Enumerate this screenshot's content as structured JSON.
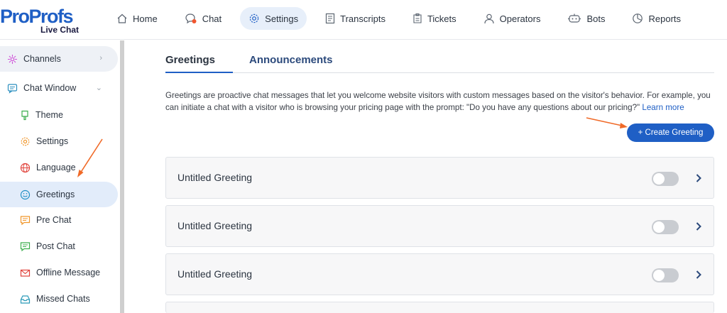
{
  "brand": {
    "logo_part1": "Pro",
    "logo_part2": "Profs",
    "product": "Live Chat"
  },
  "nav": [
    {
      "label": "Home",
      "icon": "home-icon"
    },
    {
      "label": "Chat",
      "icon": "chat-icon"
    },
    {
      "label": "Settings",
      "icon": "gear-icon",
      "active": true
    },
    {
      "label": "Transcripts",
      "icon": "transcripts-icon"
    },
    {
      "label": "Tickets",
      "icon": "tickets-icon"
    },
    {
      "label": "Operators",
      "icon": "user-icon"
    },
    {
      "label": "Bots",
      "icon": "bot-icon"
    },
    {
      "label": "Reports",
      "icon": "pie-chart-icon"
    }
  ],
  "sidebar": {
    "channels": "Channels",
    "chat_window": "Chat Window",
    "items": [
      {
        "label": "Theme",
        "icon": "theme-icon"
      },
      {
        "label": "Settings",
        "icon": "gear-icon"
      },
      {
        "label": "Language",
        "icon": "globe-icon"
      },
      {
        "label": "Greetings",
        "icon": "smiley-icon",
        "active": true
      },
      {
        "label": "Pre Chat",
        "icon": "pre-chat-icon"
      },
      {
        "label": "Post Chat",
        "icon": "post-chat-icon"
      },
      {
        "label": "Offline Message",
        "icon": "envelope-icon"
      },
      {
        "label": "Missed Chats",
        "icon": "inbox-icon"
      }
    ]
  },
  "tabs": {
    "greetings": "Greetings",
    "announcements": "Announcements"
  },
  "description": {
    "text": "Greetings are proactive chat messages that let you welcome website visitors with custom messages based on the visitor's behavior. For example, you can initiate a chat with a visitor who is browsing your pricing page with the prompt: \"Do you have any questions about our pricing?\"",
    "link": "Learn more"
  },
  "create_button": "+ Create Greeting",
  "greetings": [
    {
      "title": "Untitled Greeting",
      "enabled": false
    },
    {
      "title": "Untitled Greeting",
      "enabled": false
    },
    {
      "title": "Untitled Greeting",
      "enabled": false
    }
  ],
  "colors": {
    "accent": "#1f5fc5",
    "arrow": "#f06a28",
    "active_bg": "#e2ecfa"
  }
}
